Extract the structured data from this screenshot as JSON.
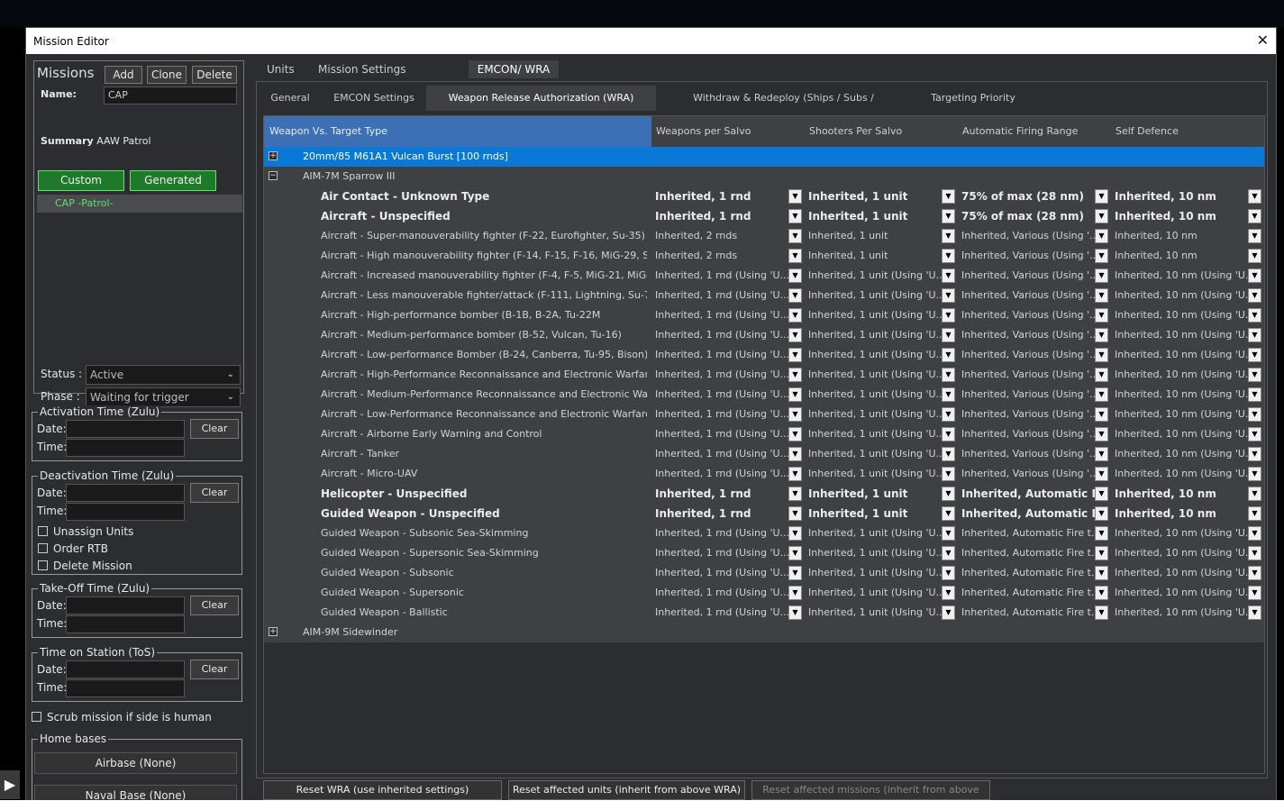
{
  "window": {
    "title": "Mission Editor",
    "close_glyph": "✕"
  },
  "missions": {
    "label": "Missions",
    "add_label": "Add",
    "clone_label": "Clone",
    "delete_label": "Delete",
    "name_label": "Name:",
    "name_value": "CAP",
    "summary_label": "Summary",
    "summary_value": "AAW Patrol",
    "custom_label": "Custom",
    "generated_label": "Generated",
    "list": [
      "CAP -Patrol-"
    ],
    "status_label": "Status :",
    "status_value": "Active",
    "phase_label": "Phase :",
    "phase_value": "Waiting for trigger"
  },
  "activation": {
    "legend": "Activation Time (Zulu)",
    "date_label": "Date:",
    "time_label": "Time:",
    "clear_label": "Clear"
  },
  "deactivation": {
    "legend": "Deactivation Time (Zulu)",
    "date_label": "Date:",
    "time_label": "Time:",
    "clear_label": "Clear",
    "unassign_label": "Unassign Units",
    "order_rtb_label": "Order RTB",
    "delete_mission_label": "Delete Mission"
  },
  "takeoff": {
    "legend": "Take-Off Time (Zulu)",
    "date_label": "Date:",
    "time_label": "Time:",
    "clear_label": "Clear"
  },
  "tos": {
    "legend": "Time on Station (ToS)",
    "date_label": "Date:",
    "time_label": "Time:",
    "clear_label": "Clear"
  },
  "scrub_label": "Scrub mission if side is human",
  "home_bases": {
    "legend": "Home bases",
    "airbase": "Airbase (None)",
    "naval": "Naval Base (None)"
  },
  "top_tabs": [
    "Units",
    "Mission Settings",
    "EMCON/ WRA"
  ],
  "sub_tabs": [
    "General",
    "EMCON Settings",
    "Weapon Release Authorization (WRA)",
    "Withdraw & Redeploy (Ships / Subs / Land)",
    "Targeting Priority"
  ],
  "columns": [
    "Weapon Vs. Target Type",
    "Weapons per Salvo",
    "Shooters Per Salvo",
    "Automatic Firing Range",
    "Self Defence"
  ],
  "rows": [
    {
      "level": 0,
      "exp": "+",
      "name": "20mm/85 M61A1 Vulcan Burst [100 rnds]",
      "selected": true
    },
    {
      "level": 0,
      "exp": "−",
      "name": "AIM-7M Sparrow III"
    },
    {
      "level": 1,
      "bold": true,
      "name": "Air Contact - Unknown Type",
      "v": [
        "Inherited, 1 rnd",
        "Inherited, 1 unit",
        "75% of max (28 nm)",
        "Inherited, 10 nm"
      ]
    },
    {
      "level": 1,
      "bold": true,
      "name": "Aircraft - Unspecified",
      "v": [
        "Inherited, 1 rnd",
        "Inherited, 1 unit",
        "75% of max (28 nm)",
        "Inherited, 10 nm"
      ]
    },
    {
      "level": 1,
      "name": "Aircraft - Super-manouverability fighter (F-22, Eurofighter, Su-35)",
      "v": [
        "Inherited, 2 rnds",
        "Inherited, 1 unit",
        "Inherited, Various (Using '...",
        "Inherited, 10 nm"
      ]
    },
    {
      "level": 1,
      "name": "Aircraft - High manouverability fighter (F-14, F-15, F-16, MiG-29, Su-27)",
      "v": [
        "Inherited, 2 rnds",
        "Inherited, 1 unit",
        "Inherited, Various (Using '...",
        "Inherited, 10 nm"
      ]
    },
    {
      "level": 1,
      "name": "Aircraft - Increased manouverability fighter (F-4, F-5, MiG-21, MiG-23)",
      "v": [
        "Inherited, 1 rnd (Using 'U...",
        "Inherited, 1 unit (Using 'U...",
        "Inherited, Various (Using '...",
        "Inherited, 10 nm (Using 'U..."
      ]
    },
    {
      "level": 1,
      "name": "Aircraft - Less manouverable fighter/attack (F-111, Lightning, Su-7, M...",
      "v": [
        "Inherited, 1 rnd (Using 'U...",
        "Inherited, 1 unit (Using 'U...",
        "Inherited, Various (Using '...",
        "Inherited, 10 nm (Using 'U..."
      ]
    },
    {
      "level": 1,
      "name": "Aircraft - High-performance bomber (B-1B, B-2A, Tu-22M",
      "v": [
        "Inherited, 1 rnd (Using 'U...",
        "Inherited, 1 unit (Using 'U...",
        "Inherited, Various (Using '...",
        "Inherited, 10 nm (Using 'U..."
      ]
    },
    {
      "level": 1,
      "name": "Aircraft - Medium-performance bomber (B-52, Vulcan, Tu-16)",
      "v": [
        "Inherited, 1 rnd (Using 'U...",
        "Inherited, 1 unit (Using 'U...",
        "Inherited, Various (Using '...",
        "Inherited, 10 nm (Using 'U..."
      ]
    },
    {
      "level": 1,
      "name": "Aircraft - Low-performance Bomber (B-24, Canberra, Tu-95, Bison)",
      "v": [
        "Inherited, 1 rnd (Using 'U...",
        "Inherited, 1 unit (Using 'U...",
        "Inherited, Various (Using '...",
        "Inherited, 10 nm (Using 'U..."
      ]
    },
    {
      "level": 1,
      "name": "Aircraft - High-Performance Reconnaissance and Electronic Warfare",
      "v": [
        "Inherited, 1 rnd (Using 'U...",
        "Inherited, 1 unit (Using 'U...",
        "Inherited, Various (Using '...",
        "Inherited, 10 nm (Using 'U..."
      ]
    },
    {
      "level": 1,
      "name": "Aircraft - Medium-Performance Reconnaissance and Electronic Warfare",
      "v": [
        "Inherited, 1 rnd (Using 'U...",
        "Inherited, 1 unit (Using 'U...",
        "Inherited, Various (Using '...",
        "Inherited, 10 nm (Using 'U..."
      ]
    },
    {
      "level": 1,
      "name": "Aircraft - Low-Performance Reconnaissance and Electronic Warfare",
      "v": [
        "Inherited, 1 rnd (Using 'U...",
        "Inherited, 1 unit (Using 'U...",
        "Inherited, Various (Using '...",
        "Inherited, 10 nm (Using 'U..."
      ]
    },
    {
      "level": 1,
      "name": "Aircraft - Airborne Early Warning and Control",
      "v": [
        "Inherited, 1 rnd (Using 'U...",
        "Inherited, 1 unit (Using 'U...",
        "Inherited, Various (Using '...",
        "Inherited, 10 nm (Using 'U..."
      ]
    },
    {
      "level": 1,
      "name": "Aircraft - Tanker",
      "v": [
        "Inherited, 1 rnd (Using 'U...",
        "Inherited, 1 unit (Using 'U...",
        "Inherited, Various (Using '...",
        "Inherited, 10 nm (Using 'U..."
      ]
    },
    {
      "level": 1,
      "name": "Aircraft - Micro-UAV",
      "v": [
        "Inherited, 1 rnd (Using 'U...",
        "Inherited, 1 unit (Using 'U...",
        "Inherited, Various (Using '...",
        "Inherited, 10 nm (Using 'U..."
      ]
    },
    {
      "level": 1,
      "bold": true,
      "name": "Helicopter - Unspecified",
      "v": [
        "Inherited, 1 rnd",
        "Inherited, 1 unit",
        "Inherited, Automatic Fir...",
        "Inherited, 10 nm"
      ]
    },
    {
      "level": 1,
      "bold": true,
      "name": "Guided Weapon - Unspecified",
      "v": [
        "Inherited, 1 rnd",
        "Inherited, 1 unit",
        "Inherited, Automatic Fir...",
        "Inherited, 10 nm"
      ]
    },
    {
      "level": 1,
      "name": "Guided Weapon - Subsonic Sea-Skimming",
      "v": [
        "Inherited, 1 rnd (Using 'U...",
        "Inherited, 1 unit (Using 'U...",
        "Inherited, Automatic Fire t...",
        "Inherited, 10 nm (Using 'U..."
      ]
    },
    {
      "level": 1,
      "name": "Guided Weapon - Supersonic Sea-Skimming",
      "v": [
        "Inherited, 1 rnd (Using 'U...",
        "Inherited, 1 unit (Using 'U...",
        "Inherited, Automatic Fire t...",
        "Inherited, 10 nm (Using 'U..."
      ]
    },
    {
      "level": 1,
      "name": "Guided Weapon - Subsonic",
      "v": [
        "Inherited, 1 rnd (Using 'U...",
        "Inherited, 1 unit (Using 'U...",
        "Inherited, Automatic Fire t...",
        "Inherited, 10 nm (Using 'U..."
      ]
    },
    {
      "level": 1,
      "name": "Guided Weapon - Supersonic",
      "v": [
        "Inherited, 1 rnd (Using 'U...",
        "Inherited, 1 unit (Using 'U...",
        "Inherited, Automatic Fire t...",
        "Inherited, 10 nm (Using 'U..."
      ]
    },
    {
      "level": 1,
      "name": "Guided Weapon - Ballistic",
      "v": [
        "Inherited, 1 rnd (Using 'U...",
        "Inherited, 1 unit (Using 'U...",
        "Inherited, Automatic Fire t...",
        "Inherited, 10 nm (Using 'U..."
      ]
    },
    {
      "level": 0,
      "exp": "+",
      "name": "AIM-9M Sidewinder"
    }
  ],
  "bottom_buttons": [
    "Reset WRA (use inherited settings)",
    "Reset affected units (inherit from above WRA)",
    "Reset affected missions (inherit from above WRA)"
  ],
  "colors": {
    "selected_row": "#0a78d6",
    "header_highlight": "#3d6fb4",
    "custom_green": "#1e7a2a",
    "mission_text": "#5fe06e"
  }
}
